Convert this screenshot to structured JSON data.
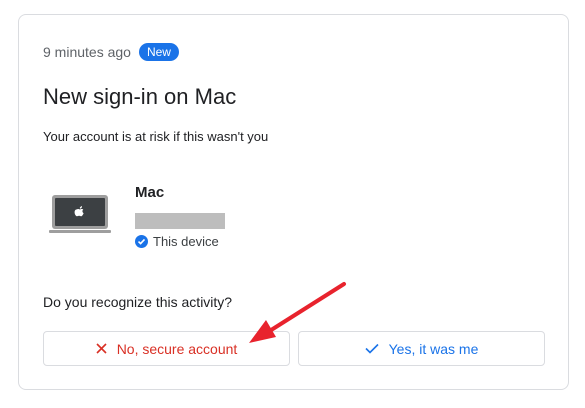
{
  "card": {
    "time": "9 minutes ago",
    "badge": "New",
    "title": "New sign-in on Mac",
    "subtitle": "Your account is at risk if this wasn't you",
    "device": {
      "name": "Mac",
      "status": "This device",
      "icon": "laptop-icon"
    },
    "question": "Do you recognize this activity?",
    "buttons": {
      "no_label": "No, secure account",
      "yes_label": "Yes, it was me"
    }
  },
  "colors": {
    "accent": "#1a73e8",
    "danger": "#d93025",
    "annotation_arrow": "#e8232d"
  }
}
